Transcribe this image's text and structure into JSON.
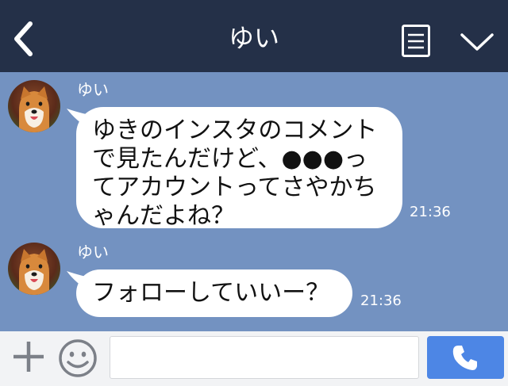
{
  "header": {
    "title": "ゆい"
  },
  "messages": [
    {
      "sender": "ゆい",
      "text": "ゆきのインスタのコメント\nで見たんだけど、●●●っ\nてアカウントってさやかち\nゃんだよね？",
      "time": "21:36"
    },
    {
      "sender": "ゆい",
      "text": "フォローしていいー？",
      "time": "21:36"
    }
  ],
  "input": {
    "placeholder": ""
  },
  "colors": {
    "header_bg": "#243048",
    "chat_bg": "#7392c1",
    "bubble_bg": "#ffffff",
    "call_button": "#4d86e5"
  },
  "icons": {
    "back": "chevron-left-icon",
    "menu": "note-icon",
    "collapse": "chevron-down-icon",
    "add": "plus-icon",
    "emoji": "smiley-icon",
    "call": "phone-icon"
  }
}
